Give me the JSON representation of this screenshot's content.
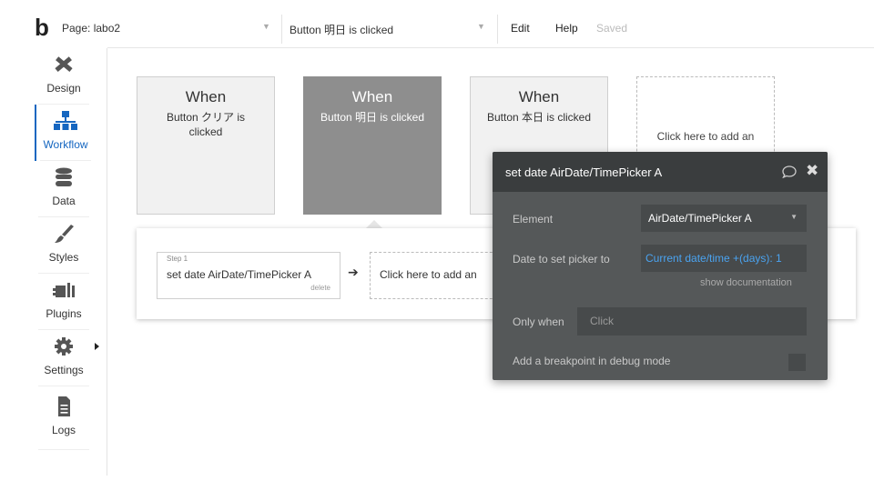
{
  "topbar": {
    "logo": "b",
    "page_label": "Page: labo2",
    "event_label": "Button 明日 is clicked",
    "menu_edit": "Edit",
    "menu_help": "Help",
    "saved_status": "Saved"
  },
  "sidebar": {
    "items": [
      {
        "label": "Design",
        "icon": "design-tools-icon"
      },
      {
        "label": "Workflow",
        "icon": "workflow-icon"
      },
      {
        "label": "Data",
        "icon": "database-icon"
      },
      {
        "label": "Styles",
        "icon": "brush-icon"
      },
      {
        "label": "Plugins",
        "icon": "plugin-icon"
      },
      {
        "label": "Settings",
        "icon": "gear-icon"
      },
      {
        "label": "Logs",
        "icon": "document-icon"
      }
    ]
  },
  "events": [
    {
      "when": "When",
      "desc": "Button クリア is clicked"
    },
    {
      "when": "When",
      "desc": "Button 明日 is clicked"
    },
    {
      "when": "When",
      "desc": "Button 本日 is clicked"
    }
  ],
  "add_event_text": "Click here to add an",
  "actions": {
    "step_no": "Step 1",
    "step_title": "set date AirDate/TimePicker A",
    "step_delete": "delete",
    "add_action_text": "Click here to add an"
  },
  "dialog": {
    "title": "set date AirDate/TimePicker A",
    "element_label": "Element",
    "element_value": "AirDate/TimePicker A",
    "date_label": "Date to set picker to",
    "date_value": "Current date/time +(days): 1",
    "show_doc": "show documentation",
    "only_when_label": "Only when",
    "only_when_placeholder": "Click",
    "breakpoint_label": "Add a breakpoint in debug mode"
  },
  "colors": {
    "accent": "#1566c0",
    "selected_card": "#8e8e8e",
    "dialog_bg": "#555859",
    "link_blue": "#4aa3f0"
  }
}
